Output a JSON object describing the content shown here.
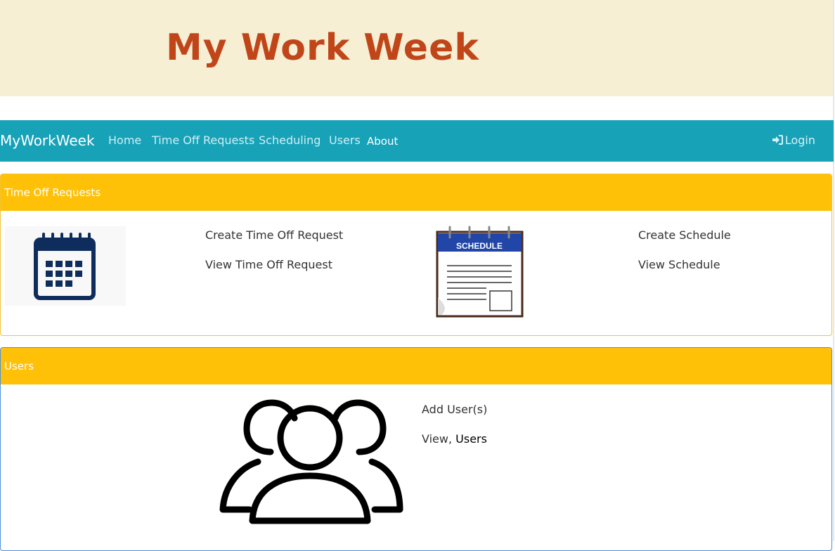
{
  "banner": {
    "title": "My Work Week"
  },
  "navbar": {
    "brand": "MyWorkWeek",
    "links": [
      {
        "label": "Home"
      },
      {
        "label": "Time Off Requests"
      },
      {
        "label": "Scheduling"
      },
      {
        "label": "Users"
      },
      {
        "label": "About"
      }
    ],
    "login": {
      "icon": "sign-in-icon",
      "label": "Login"
    }
  },
  "time_off_card": {
    "header": "Time Off Requests",
    "icon": "calendar-icon",
    "links": [
      "Create Time Off Request",
      "View Time Off Request"
    ],
    "schedule_icon": {
      "name": "schedule-notepad-icon",
      "label": "SCHEDULE"
    },
    "schedule_links": [
      "Create Schedule",
      "View Schedule"
    ]
  },
  "users_card": {
    "header": "Users",
    "icon": "users-group-icon",
    "links": {
      "add": "Add User(s)",
      "view_prefix": "View,",
      "view_target": "Users"
    }
  },
  "colors": {
    "banner_bg": "#f7efd4",
    "banner_title": "#c0461a",
    "navbar": "#17a2b8",
    "card_header": "#ffc107",
    "calendar": "#0f2d5c",
    "schedule_header": "#2146a8"
  }
}
